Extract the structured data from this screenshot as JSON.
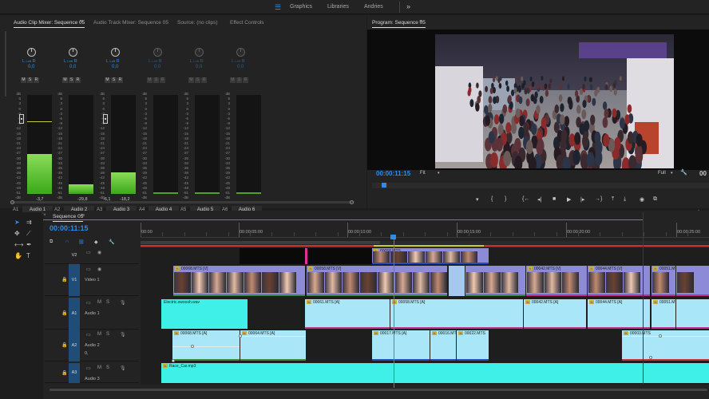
{
  "topbar": {
    "workspaces": [
      "Graphics",
      "Libraries",
      "Andries"
    ],
    "more": "»"
  },
  "mixer": {
    "tabs": [
      "Audio Clip Mixer: Sequence 05",
      "Audio Track Mixer: Sequence 05",
      "Source: (no clips)",
      "Effect Controls"
    ],
    "channels": [
      {
        "id": "A1",
        "name": "Audio 1",
        "pan": "0,0",
        "left": "",
        "right": "-3,7",
        "level": 0.4,
        "peak": 0.27,
        "active": true,
        "fader": true
      },
      {
        "id": "A2",
        "name": "Audio 2",
        "pan": "0,0",
        "left": "",
        "right": "-29,8",
        "level": 0.1,
        "peak": null,
        "active": true,
        "fader": false
      },
      {
        "id": "A3",
        "name": "Audio 3",
        "pan": "0,0",
        "left": "-6,1",
        "right": "-18,2",
        "level": 0.22,
        "peak": null,
        "active": true,
        "fader": true
      },
      {
        "id": "A4",
        "name": "Audio 4",
        "pan": "0,0",
        "left": "",
        "right": "",
        "level": 0.0,
        "peak": null,
        "active": false,
        "fader": false
      },
      {
        "id": "A5",
        "name": "Audio 5",
        "pan": "0,0",
        "left": "",
        "right": "",
        "level": 0.0,
        "peak": null,
        "active": false,
        "fader": false
      },
      {
        "id": "A6",
        "name": "Audio 6",
        "pan": "0,0",
        "left": "",
        "right": "",
        "level": 0.0,
        "peak": null,
        "active": false,
        "fader": false
      }
    ],
    "lr_l": "L",
    "lr_r": "R",
    "lr_mid": "Left",
    "msr": [
      "M",
      "S",
      "R"
    ],
    "scale": [
      "dB",
      "6",
      "3",
      "0",
      "-3",
      "-6",
      "-9",
      "-12",
      "-15",
      "-18",
      "-21",
      "-24",
      "-27",
      "-30",
      "-33",
      "-36",
      "-39",
      "-42",
      "-45",
      "-48",
      "-51",
      "-dB"
    ]
  },
  "program": {
    "title": "Program: Sequence 05",
    "timecode": "00:00:11:15",
    "fit": "Fit",
    "quality": "Full",
    "right_tc": "00"
  },
  "timeline": {
    "tab": "Sequence 05",
    "timecode": "00:00:11:15",
    "ruler": [
      "00:00",
      "00:00:05:00",
      "00:00:10:00",
      "00:00:15:00",
      "00:00:20:00",
      "00:00:25:00"
    ],
    "tracks": {
      "v2": "V2",
      "v1": "V1",
      "video1": "Video 1",
      "a1": "A1",
      "audio1": "Audio 1",
      "a2": "A2",
      "audio2": "Audio 2",
      "a3": "A3",
      "audio3": "Audio 3",
      "zero": "0,"
    },
    "clips": {
      "v2": "00058.MTS",
      "v1a": "00068.MTS [V]",
      "v1b": "00058.MTS [V]",
      "v1c": "00042.MTS [V]",
      "v1d": "00044.MTS [V]",
      "v1e": "00051.MT",
      "a1a": "Electric.swoosh.wav",
      "a1b": "00061.MTS [A]",
      "a1c": "00058.MTS [A]",
      "a1d": "00042.MTS [A]",
      "a1e": "00044.MTS [A]",
      "a1f": "00051.MT",
      "a2a": "00068.MTS [A]",
      "a2b": "00064.MTS [A]",
      "a2c": "00017.MTS [A]",
      "a2d": "00016.MT",
      "a2e": "00022.MTS",
      "a2f": "00003.MTS",
      "a3a": "Race_Car.mp3"
    }
  }
}
